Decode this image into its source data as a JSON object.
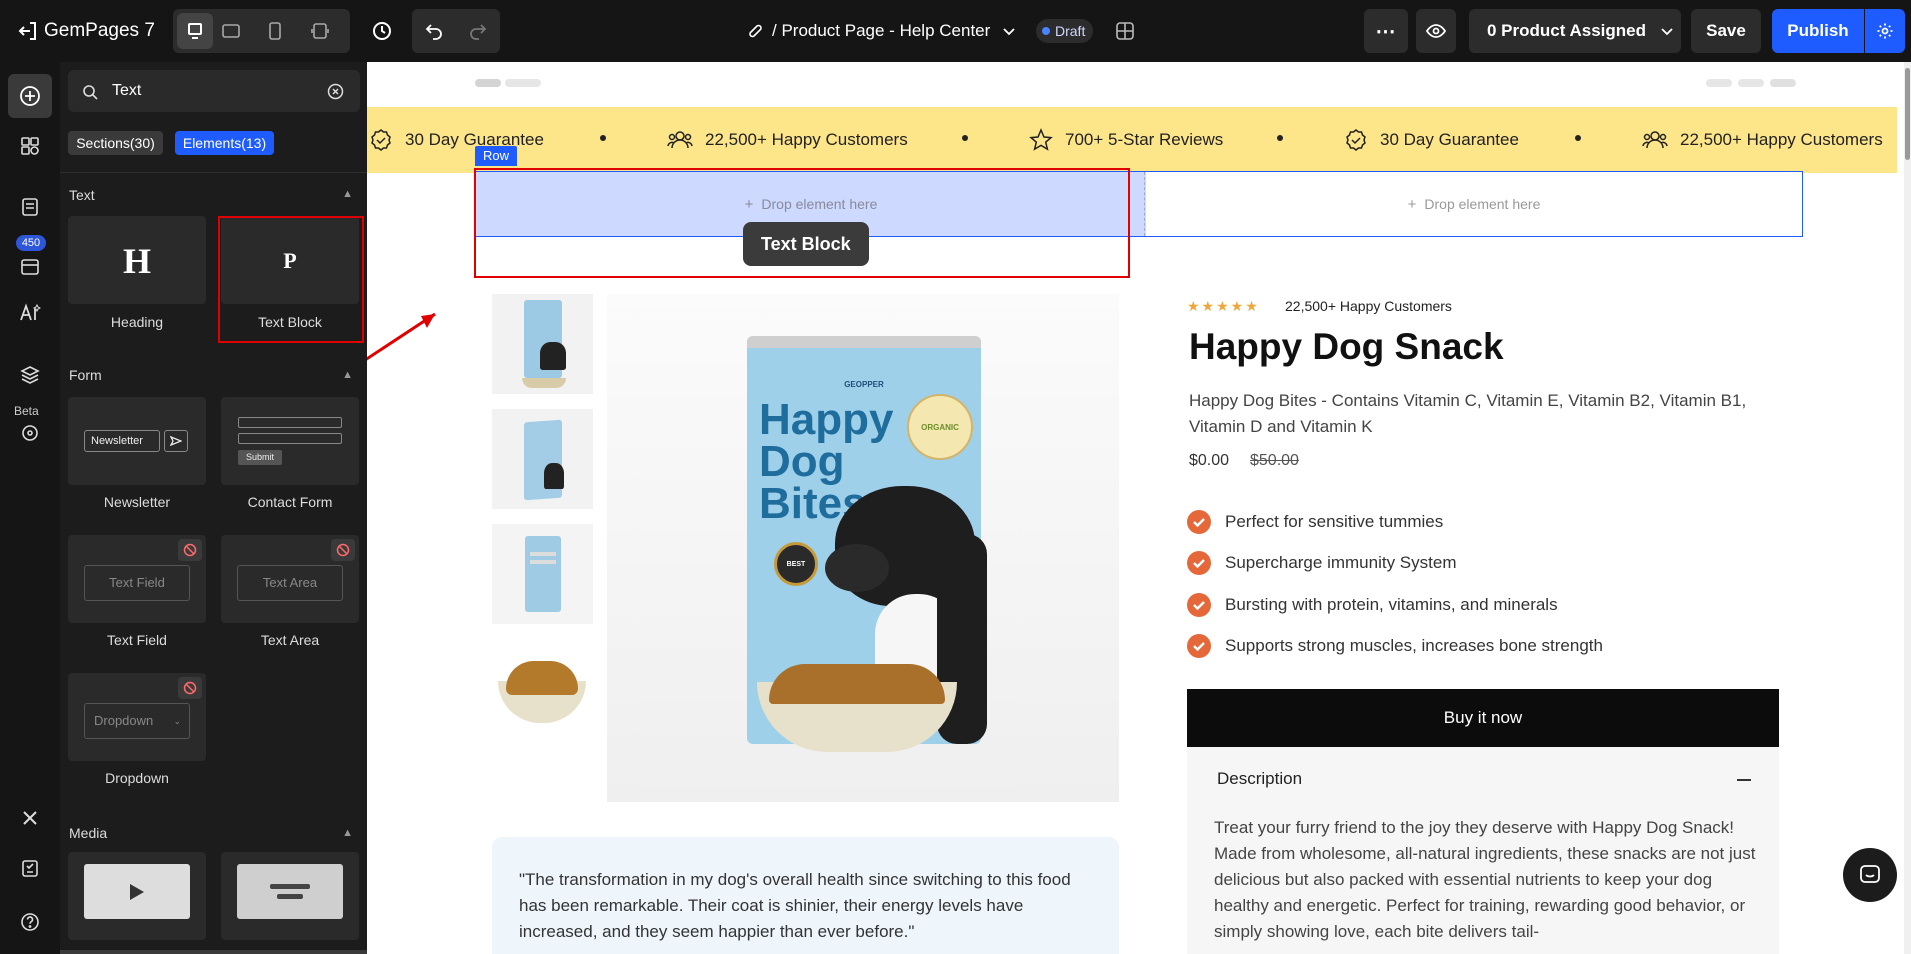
{
  "topbar": {
    "app_name": "GemPages 7",
    "page_path": "/ Product Page - Help Center",
    "status_badge": "Draft",
    "product_assigned": "0 Product Assigned",
    "save_label": "Save",
    "publish_label": "Publish"
  },
  "rail": {
    "credits": "450",
    "beta_label": "Beta"
  },
  "panel": {
    "search_value": "Text",
    "tabs": [
      "Sections(30)",
      "Elements(13)"
    ],
    "sections": {
      "text": "Text",
      "form": "Form",
      "media": "Media"
    },
    "elements": {
      "heading": "Heading",
      "text_block": "Text Block",
      "newsletter": "Newsletter",
      "contact_form": "Contact Form",
      "text_field": "Text Field",
      "text_area": "Text Area",
      "dropdown": "Dropdown"
    },
    "previews": {
      "heading_glyph": "H",
      "text_block_glyph": "P",
      "newsletter_input": "Newsletter",
      "submit": "Submit",
      "text_field": "Text Field",
      "text_area": "Text Area",
      "dropdown": "Dropdown"
    }
  },
  "canvas": {
    "marquee": [
      "30 Day Guarantee",
      "22,500+ Happy Customers",
      "700+ 5-Star Reviews",
      "30 Day Guarantee",
      "22,500+ Happy Customers"
    ],
    "row_label": "Row",
    "drop_here": "Drop element here",
    "drag_ghost": "Text Block",
    "product": {
      "reviews_count": "22,500+ Happy Customers",
      "title": "Happy Dog Snack",
      "subtitle": "Happy Dog Bites - Contains Vitamin C, Vitamin E, Vitamin B2, Vitamin B1, Vitamin D and Vitamin K",
      "price": "$0.00",
      "compare_price": "$50.00",
      "benefits": [
        "Perfect for sensitive tummies",
        "Supercharge immunity System",
        "Bursting with protein, vitamins, and minerals",
        "Supports strong muscles, increases bone strength"
      ],
      "buy_label": "Buy it now",
      "description_title": "Description",
      "description_text": "Treat your furry friend to the joy they deserve with Happy Dog Snack! Made from wholesome, all-natural ingredients, these snacks are not just delicious but also packed with essential nutrients to keep your dog healthy and energetic. Perfect for training, rewarding good behavior, or simply showing love, each bite delivers tail-",
      "testimonial": "\"The transformation in my dog's overall health since switching to this food has been remarkable. Their coat is shinier, their energy levels have increased, and they seem happier than ever before.\"",
      "bag": {
        "brand": "GEOPPER",
        "line1": "Happy",
        "line2": "Dog",
        "line3": "Bites",
        "organic": "ORGANIC",
        "best": "BEST"
      }
    }
  },
  "colors": {
    "accent_blue": "#1f5cff",
    "marquee_bg": "#fde58a",
    "selection_red": "#e00000",
    "check_orange": "#e4683a",
    "row_fill": "#cdd9ff"
  }
}
